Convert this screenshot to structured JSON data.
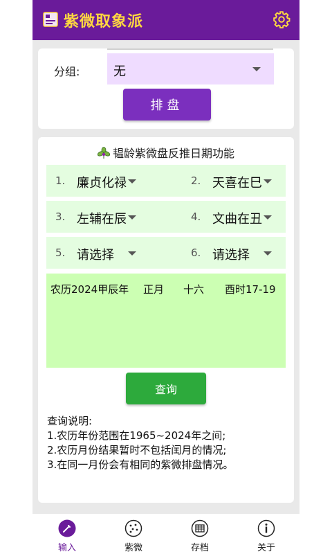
{
  "app": {
    "title": "紫微取象派",
    "icons": {
      "app": "book-icon",
      "settings": "gear-icon"
    },
    "colors": {
      "appbar": "#6a1b9a",
      "title": "#ffd740",
      "accent": "#7b2fbe",
      "green_button": "#2daa3c"
    }
  },
  "group": {
    "label": "分组:",
    "value": "无",
    "button": "排盘"
  },
  "reverse": {
    "title": "韫龄紫微盘反推日期功能",
    "selectors": [
      {
        "num": "1.",
        "value": "廉贞化禄"
      },
      {
        "num": "2.",
        "value": "天喜在巳"
      },
      {
        "num": "3.",
        "value": "左辅在辰"
      },
      {
        "num": "4.",
        "value": "文曲在丑"
      },
      {
        "num": "5.",
        "value": "请选择"
      },
      {
        "num": "6.",
        "value": "请选择"
      }
    ],
    "result": {
      "year": "农历2024甲辰年",
      "month": "正月",
      "day": "十六",
      "hour": "酉时17-19"
    },
    "query_button": "查询",
    "notes": [
      "查询说明:",
      "1.农历年份范围在1965~2024年之间;",
      "2.农历月份结果暂时不包括闰月的情况;",
      "3.在同一月份会有相同的紫微排盘情况。"
    ]
  },
  "nav": {
    "items": [
      {
        "label": "输入",
        "icon": "pen-icon"
      },
      {
        "label": "紫微",
        "icon": "starchart-icon"
      },
      {
        "label": "存档",
        "icon": "archive-icon"
      },
      {
        "label": "关于",
        "icon": "info-icon"
      }
    ]
  }
}
